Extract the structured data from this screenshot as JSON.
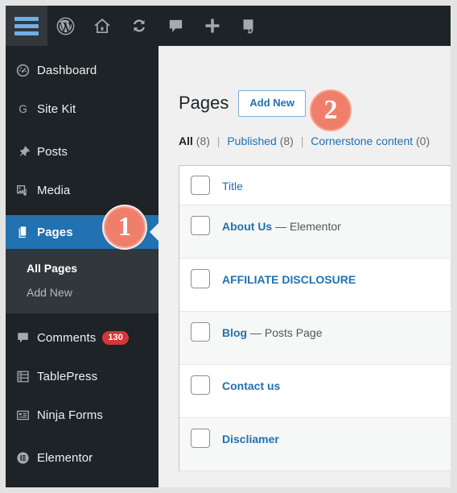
{
  "adminbar": {
    "menu_toggle": "menu-toggle-icon",
    "items": [
      {
        "name": "wordpress-logo-icon",
        "label": "WordPress"
      },
      {
        "name": "site-home-icon",
        "label": "Visit Site"
      },
      {
        "name": "updates-icon",
        "label": "Updates"
      },
      {
        "name": "comments-icon",
        "label": "Comments"
      },
      {
        "name": "new-content-icon",
        "label": "New"
      },
      {
        "name": "yoast-seo-icon",
        "label": "Yoast SEO"
      }
    ]
  },
  "sidebar": {
    "items": [
      {
        "label": "Dashboard",
        "icon": "dashboard-icon",
        "current": false
      },
      {
        "label": "Site Kit",
        "icon": "site-kit-icon",
        "current": false
      },
      {
        "label": "Posts",
        "icon": "pin-icon",
        "current": false
      },
      {
        "label": "Media",
        "icon": "media-icon",
        "current": false
      },
      {
        "label": "Pages",
        "icon": "pages-icon",
        "current": true
      },
      {
        "label": "Comments",
        "icon": "comment-bubble-icon",
        "badge": "130",
        "current": false
      },
      {
        "label": "TablePress",
        "icon": "tablepress-icon",
        "current": false
      },
      {
        "label": "Ninja Forms",
        "icon": "ninja-forms-icon",
        "current": false
      },
      {
        "label": "Elementor",
        "icon": "elementor-icon",
        "current": false
      }
    ],
    "submenu": [
      {
        "label": "All Pages",
        "active": true
      },
      {
        "label": "Add New",
        "active": false
      }
    ]
  },
  "main": {
    "title": "Pages",
    "add_new_label": "Add New",
    "filters": [
      {
        "label": "All",
        "count": "(8)",
        "active": true
      },
      {
        "label": "Published",
        "count": "(8)",
        "active": false
      },
      {
        "label": "Cornerstone content",
        "count": "(0)",
        "active": false
      }
    ],
    "separator": "|",
    "table": {
      "column_header": "Title",
      "rows": [
        {
          "title": "About Us",
          "note": " — Elementor"
        },
        {
          "title": "AFFILIATE DISCLOSURE",
          "note": ""
        },
        {
          "title": "Blog",
          "note": " — Posts Page"
        },
        {
          "title": "Contact us",
          "note": ""
        },
        {
          "title": "Discliamer",
          "note": ""
        }
      ]
    }
  },
  "callouts": [
    {
      "name": "step-badge-1",
      "number": "1"
    },
    {
      "name": "step-badge-2",
      "number": "2"
    }
  ],
  "colors": {
    "sidebar_bg": "#1d2327",
    "submenu_bg": "#32373c",
    "current_menu": "#2271b1",
    "link_blue": "#2271b1",
    "badge_red": "#d63638",
    "callout_coral": "#ef7f6b"
  }
}
